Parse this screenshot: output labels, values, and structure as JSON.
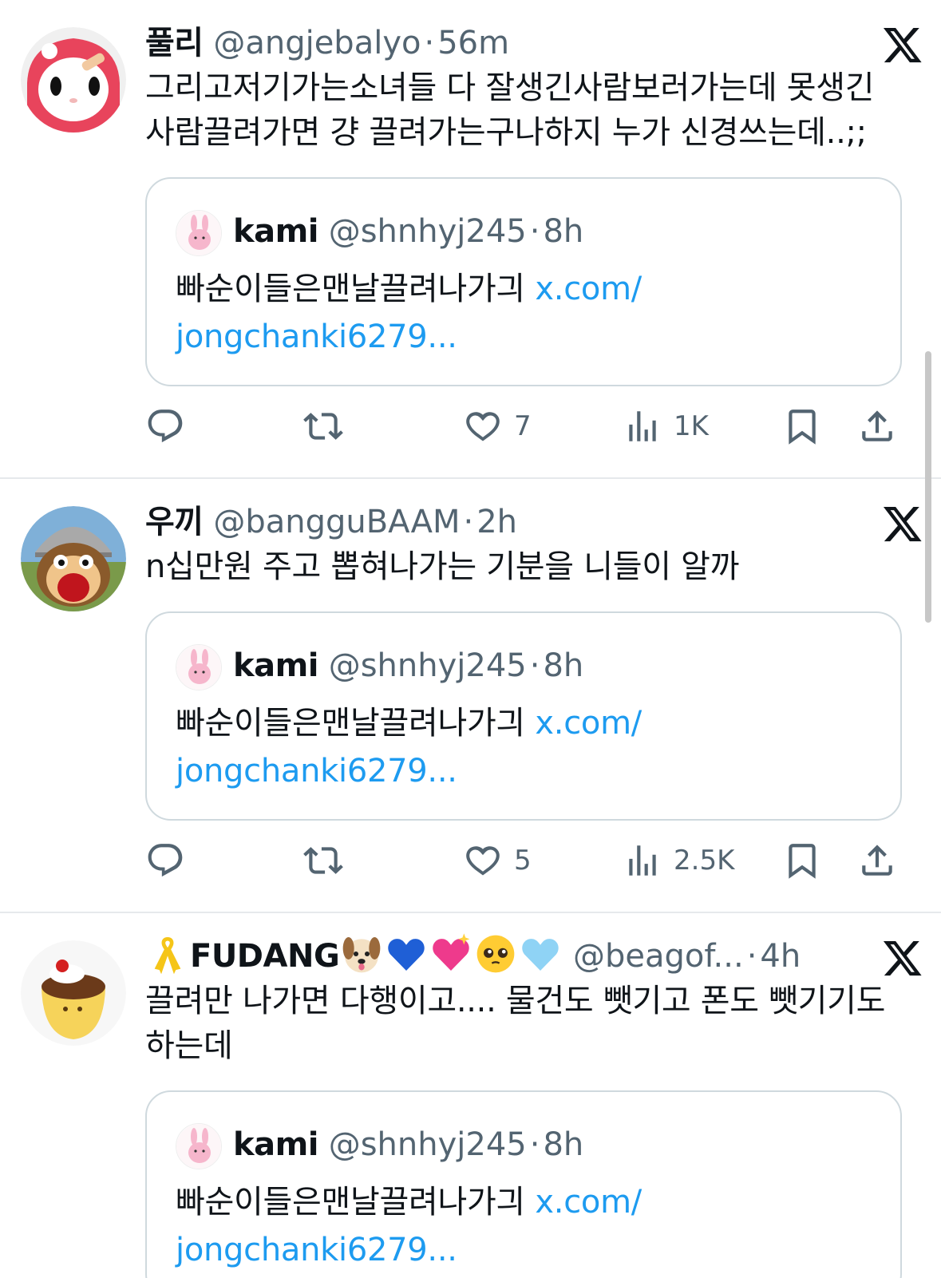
{
  "tweets": [
    {
      "name": "풀리",
      "handle": "@angjebalyo",
      "time": "56m",
      "text": "그리고저기가는소녀들 다 잘생긴사람보러가는데 못생긴 사람끌려가면 걍 끌려가는구나하지 누가 신경쓰는데..;;",
      "quote": {
        "name": "kami",
        "handle": "@shnhyj245",
        "time": "8h",
        "text": "빠순이들은맨날끌려나가긔 ",
        "link": "x.com/ jongchanki6279..."
      },
      "likes": "7",
      "views": "1K"
    },
    {
      "name": "우끼",
      "handle": "@bangguBAAM",
      "time": "2h",
      "text": "n십만원 주고 뽑혀나가는 기분을 니들이 알까",
      "quote": {
        "name": "kami",
        "handle": "@shnhyj245",
        "time": "8h",
        "text": "빠순이들은맨날끌려나가긔 ",
        "link": "x.com/ jongchanki6279..."
      },
      "likes": "5",
      "views": "2.5K"
    },
    {
      "name": "FUDANG",
      "handle": "@beagof...",
      "time": "4h",
      "text": "끌려만 나가면 다행이고.... 물건도 뺏기고 폰도 뺏기기도 하는데",
      "quote": {
        "name": "kami",
        "handle": "@shnhyj245",
        "time": "8h",
        "text": "빠순이들은맨날끌려나가긔 ",
        "link": "x.com/ jongchanki6279..."
      }
    }
  ],
  "icons": {
    "x_logo": "x-logo-icon",
    "reply": "reply-icon",
    "retweet": "retweet-icon",
    "like": "heart-icon",
    "views": "views-icon",
    "bookmark": "bookmark-icon",
    "share": "share-icon"
  },
  "colors": {
    "link": "#1d9bf0",
    "muted": "#536471",
    "border": "#cfd9de"
  }
}
